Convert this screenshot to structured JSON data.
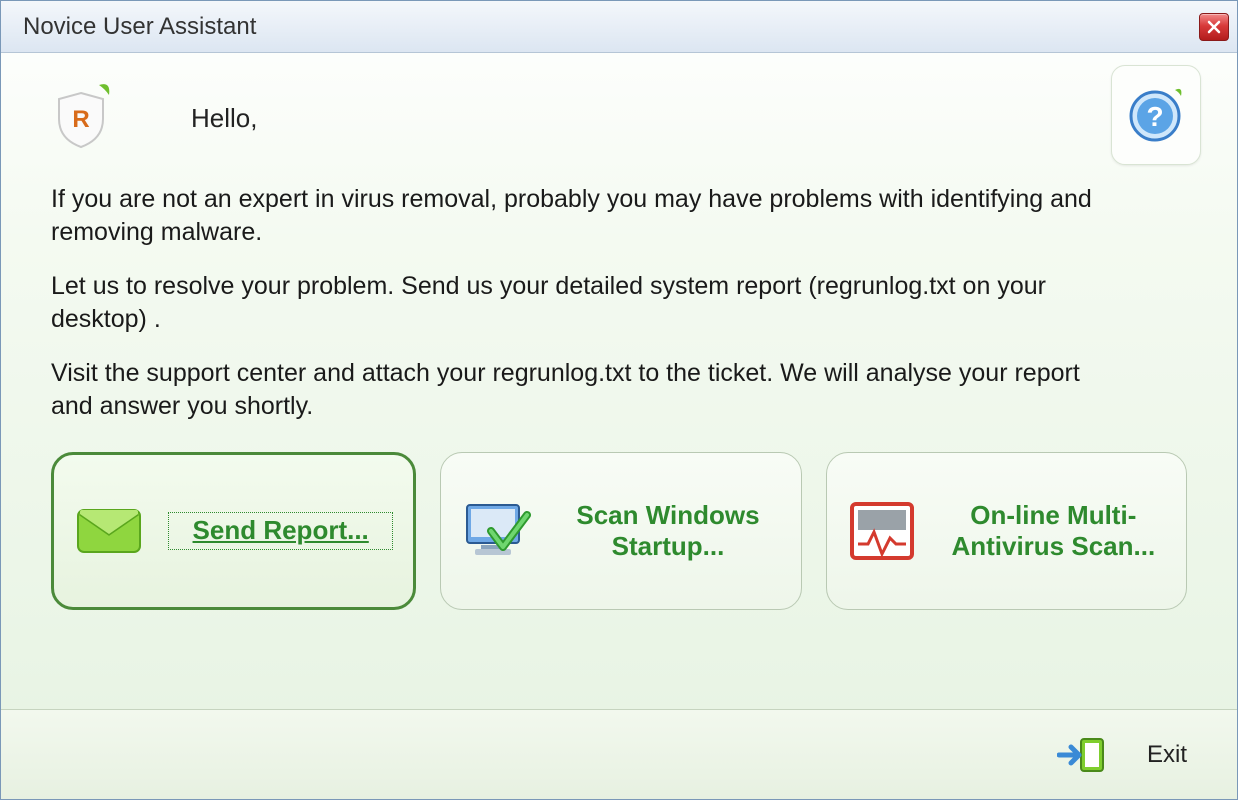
{
  "window": {
    "title": "Novice User Assistant"
  },
  "greeting": "Hello,",
  "paragraphs": {
    "p1": "If you are not an expert in virus removal, probably you may have problems with identifying and removing  malware.",
    "p2": "Let us to resolve your problem. Send us your detailed system report (regrunlog.txt on your desktop) .",
    "p3": "Visit the support center and attach your regrunlog.txt to the ticket. We will analyse your report and answer you shortly."
  },
  "actions": {
    "send_report": "Send Report...",
    "scan_startup": "Scan Windows Startup...",
    "multi_av": "On-line Multi-Antivirus Scan..."
  },
  "footer": {
    "exit": "Exit"
  },
  "icons": {
    "shield": "shield-icon",
    "help": "help-icon",
    "close": "close-icon",
    "envelope": "envelope-icon",
    "monitor": "monitor-check-icon",
    "heartbeat": "heartbeat-monitor-icon",
    "exit": "exit-door-icon"
  },
  "colors": {
    "accent_green": "#2e8a2e",
    "card_border_selected": "#4b8a3a",
    "close_red": "#d83a3a"
  }
}
